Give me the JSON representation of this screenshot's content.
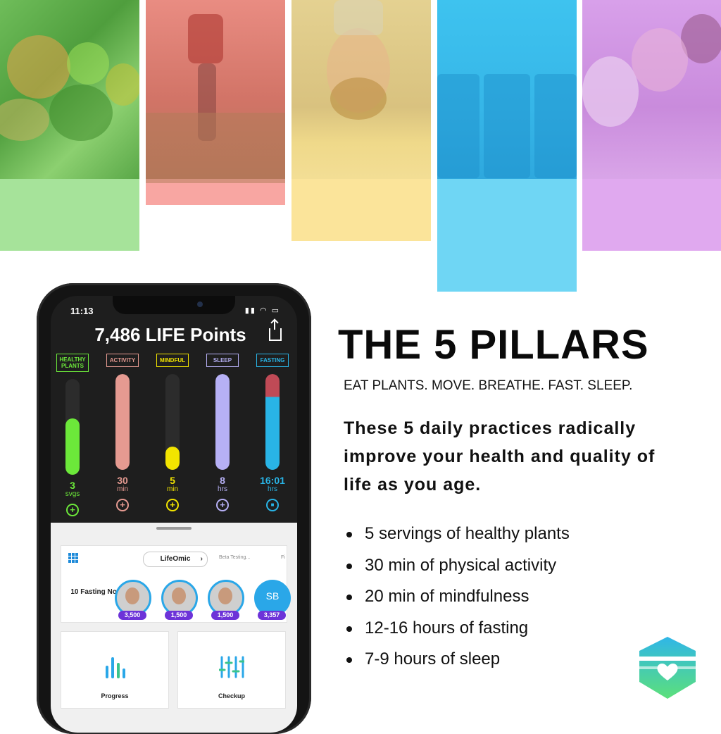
{
  "colors": {
    "plants": "#6ce83a",
    "activity": "#e86c60",
    "mindful": "#f2e400",
    "sleep": "#8c7cf0",
    "fasting": "#29b4e6",
    "fasting_top": "#c04a56",
    "avatar_ring": "#2aa7e8",
    "badge": "#6d33d8"
  },
  "phone": {
    "status_time": "11:13",
    "points_title": "7,486 LIFE Points",
    "pillars": [
      {
        "label": "HEALTHY PLANTS",
        "value": "3",
        "unit": "svgs",
        "color": "#6ce83a",
        "level": 0.59
      },
      {
        "label": "ACTIVITY",
        "value": "30",
        "unit": "min",
        "color": "#e59a91",
        "level": 1.0
      },
      {
        "label": "MINDFUL",
        "value": "5",
        "unit": "min",
        "color": "#f2e400",
        "level": 0.24
      },
      {
        "label": "SLEEP",
        "value": "8",
        "unit": "hrs",
        "color": "#b6b0f5",
        "level": 1.0
      },
      {
        "label": "FASTING",
        "value": "16:01",
        "unit": "hrs",
        "color": "#29b4e6",
        "level": 1.0
      }
    ],
    "community": {
      "tab_active": "LifeOmic",
      "tab_2": "Beta Testing...",
      "tab_3": "Fi",
      "fasting_now": "10 Fasting Now",
      "avatars": [
        {
          "badge": "3,500",
          "initials": ""
        },
        {
          "badge": "1,500",
          "initials": ""
        },
        {
          "badge": "1,500",
          "initials": ""
        },
        {
          "badge": "3,357",
          "initials": "SB"
        }
      ]
    },
    "tiles": {
      "progress": "Progress",
      "checkup": "Checkup"
    }
  },
  "content": {
    "title": "THE 5 PILLARS",
    "subtitle": "EAT PLANTS. MOVE. BREATHE. FAST. SLEEP.",
    "tagline": "These 5 daily practices radically improve your health and quality of life as you age.",
    "bullets": [
      "5 servings of healthy plants",
      "30 min of physical activity",
      "20 min of mindfulness",
      "12-16 hours of fasting",
      "7-9 hours of sleep"
    ]
  }
}
